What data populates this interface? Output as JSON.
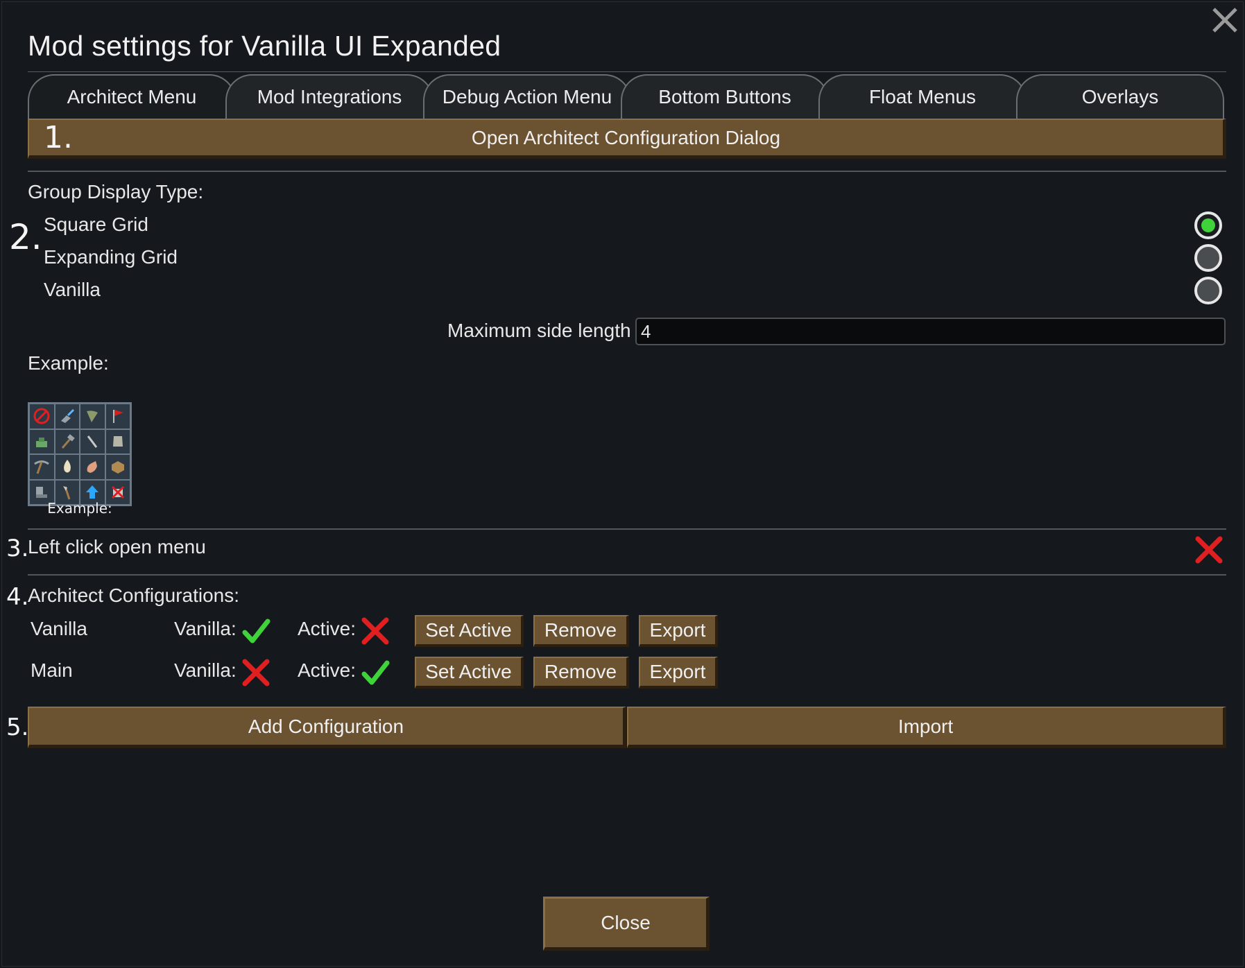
{
  "window": {
    "title": "Mod settings for Vanilla UI Expanded"
  },
  "tabs": [
    {
      "label": "Architect Menu"
    },
    {
      "label": "Mod Integrations"
    },
    {
      "label": "Debug Action Menu"
    },
    {
      "label": "Bottom Buttons"
    },
    {
      "label": "Float Menus"
    },
    {
      "label": "Overlays"
    }
  ],
  "markers": {
    "m1": "1.",
    "m2": "2.",
    "m3": "3.",
    "m4": "4.",
    "m5": "5."
  },
  "section1": {
    "open_dialog_label": "Open Architect Configuration Dialog"
  },
  "group_display": {
    "heading": "Group Display Type:",
    "options": [
      {
        "label": "Square Grid",
        "selected": true
      },
      {
        "label": "Expanding Grid",
        "selected": false
      },
      {
        "label": "Vanilla",
        "selected": false
      }
    ],
    "max_side_label": "Maximum side length",
    "max_side_value": "4"
  },
  "example": {
    "heading": "Example:",
    "caption": "Example:",
    "icons": [
      "forbid-icon",
      "shovel-icon",
      "harvest-icon",
      "flag-icon",
      "zone-icon",
      "hammer-icon",
      "knife-icon",
      "armor-icon",
      "pickaxe-icon",
      "fire-icon",
      "hand-icon",
      "crate-icon",
      "floor-icon",
      "axe-icon",
      "upgrade-icon",
      "cancel-icon"
    ]
  },
  "left_click": {
    "label": "Left click open menu",
    "enabled": false
  },
  "configurations": {
    "heading": "Architect Configurations:",
    "vanilla_label": "Vanilla:",
    "active_label": "Active:",
    "set_active_label": "Set Active",
    "remove_label": "Remove",
    "export_label": "Export",
    "rows": [
      {
        "name": "Vanilla",
        "vanilla": true,
        "active": false
      },
      {
        "name": "Main",
        "vanilla": false,
        "active": true
      }
    ]
  },
  "actions": {
    "add_label": "Add Configuration",
    "import_label": "Import"
  },
  "footer": {
    "close_label": "Close"
  },
  "colors": {
    "accent_gold": "#6b5230",
    "check_green": "#3fd23a",
    "cross_red": "#e02020",
    "background": "#15181c"
  }
}
